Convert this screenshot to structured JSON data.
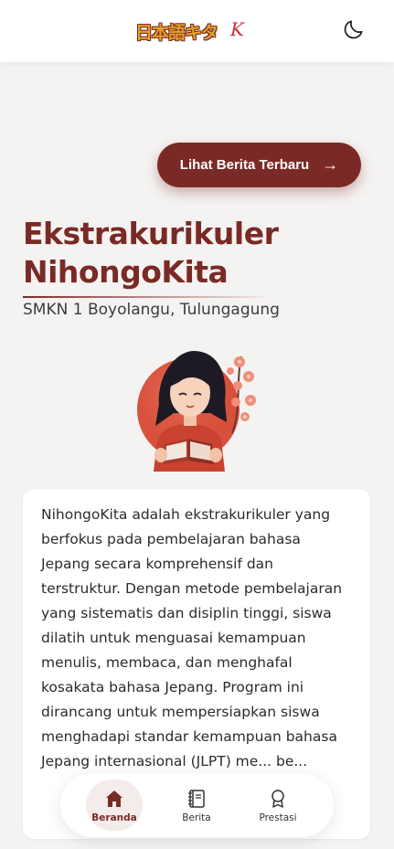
{
  "header": {
    "logo_text": "日本語キタ",
    "logo_suffix": "K",
    "theme_toggle_icon": "moon-icon"
  },
  "cta": {
    "label": "Lihat Berita Terbaru",
    "arrow": "→",
    "icon": "arrow-right-icon"
  },
  "hero": {
    "title_line1": "Ekstrakurikuler",
    "title_line2": "NihongoKita",
    "subtitle": "SMKN 1 Boyolangu, Tulungagung"
  },
  "about": {
    "text": "NihongoKita adalah ekstrakurikuler yang berfokus pada pembelajaran bahasa Jepang secara komprehensif dan terstruktur. Dengan metode pembelajaran yang sistematis dan disiplin tinggi, siswa dilatih untuk menguasai kemampuan menulis, membaca, dan menghafal kosakata bahasa Jepang. Program ini dirancang untuk mempersiapkan siswa menghadapi standar kemampuan bahasa Jepang internasional (JLPT) me... be..."
  },
  "nav": {
    "items": [
      {
        "label": "Beranda",
        "icon": "home-icon",
        "active": true
      },
      {
        "label": "Berita",
        "icon": "book-icon",
        "active": false
      },
      {
        "label": "Prestasi",
        "icon": "medal-icon",
        "active": false
      }
    ]
  },
  "colors": {
    "brand": "#7a2a26",
    "background": "#f4f3f2",
    "logo_gold": "#e3a02d"
  }
}
